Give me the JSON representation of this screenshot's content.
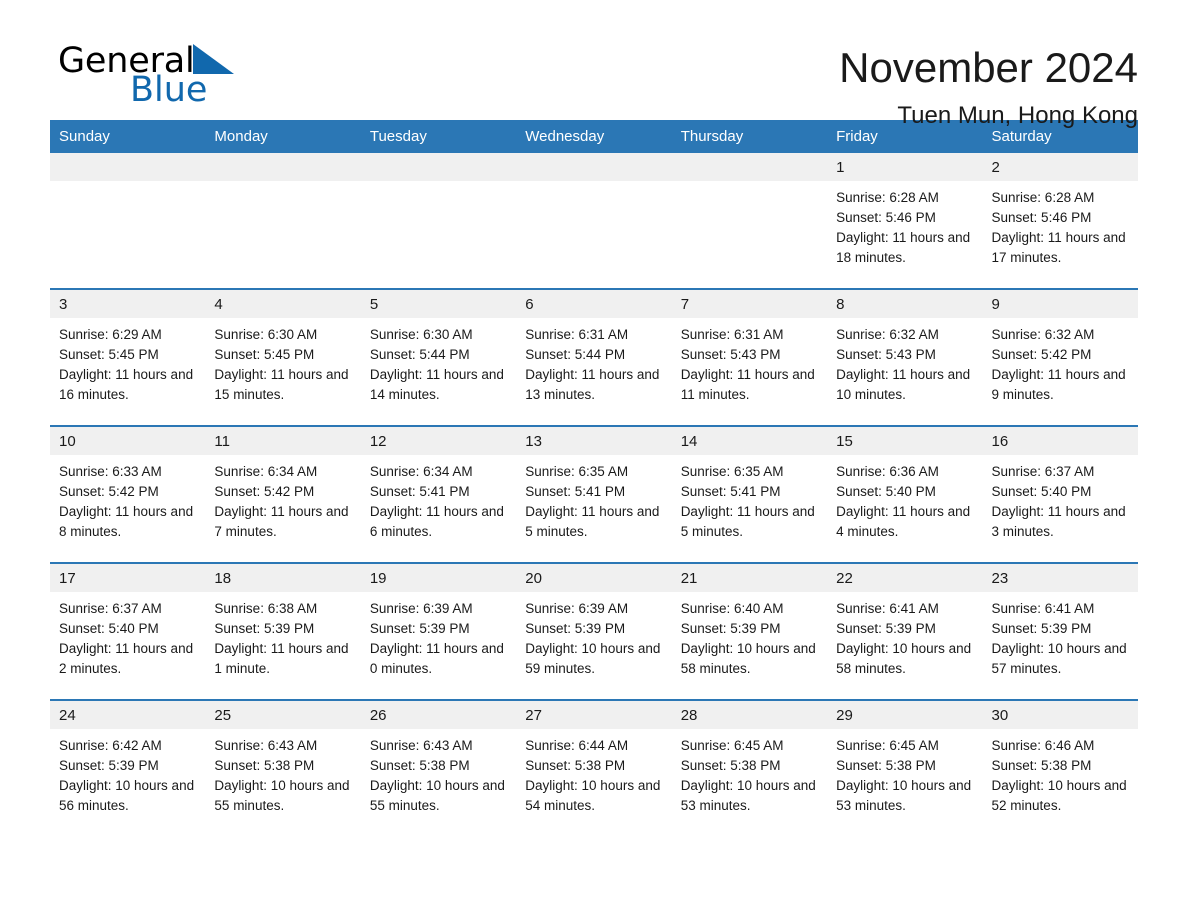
{
  "brand": {
    "name_part1": "General",
    "name_part2": "Blue",
    "triangle_color": "#1168ad"
  },
  "header": {
    "month_title": "November 2024",
    "location": "Tuen Mun, Hong Kong",
    "accent_color": "#2b77b5"
  },
  "calendar": {
    "weekdays": [
      "Sunday",
      "Monday",
      "Tuesday",
      "Wednesday",
      "Thursday",
      "Friday",
      "Saturday"
    ],
    "labels": {
      "sunrise": "Sunrise:",
      "sunset": "Sunset:",
      "daylight": "Daylight:"
    },
    "weeks": [
      [
        {
          "day": "",
          "sunrise": "",
          "sunset": "",
          "daylight": ""
        },
        {
          "day": "",
          "sunrise": "",
          "sunset": "",
          "daylight": ""
        },
        {
          "day": "",
          "sunrise": "",
          "sunset": "",
          "daylight": ""
        },
        {
          "day": "",
          "sunrise": "",
          "sunset": "",
          "daylight": ""
        },
        {
          "day": "",
          "sunrise": "",
          "sunset": "",
          "daylight": ""
        },
        {
          "day": "1",
          "sunrise": "Sunrise: 6:28 AM",
          "sunset": "Sunset: 5:46 PM",
          "daylight": "Daylight: 11 hours and 18 minutes."
        },
        {
          "day": "2",
          "sunrise": "Sunrise: 6:28 AM",
          "sunset": "Sunset: 5:46 PM",
          "daylight": "Daylight: 11 hours and 17 minutes."
        }
      ],
      [
        {
          "day": "3",
          "sunrise": "Sunrise: 6:29 AM",
          "sunset": "Sunset: 5:45 PM",
          "daylight": "Daylight: 11 hours and 16 minutes."
        },
        {
          "day": "4",
          "sunrise": "Sunrise: 6:30 AM",
          "sunset": "Sunset: 5:45 PM",
          "daylight": "Daylight: 11 hours and 15 minutes."
        },
        {
          "day": "5",
          "sunrise": "Sunrise: 6:30 AM",
          "sunset": "Sunset: 5:44 PM",
          "daylight": "Daylight: 11 hours and 14 minutes."
        },
        {
          "day": "6",
          "sunrise": "Sunrise: 6:31 AM",
          "sunset": "Sunset: 5:44 PM",
          "daylight": "Daylight: 11 hours and 13 minutes."
        },
        {
          "day": "7",
          "sunrise": "Sunrise: 6:31 AM",
          "sunset": "Sunset: 5:43 PM",
          "daylight": "Daylight: 11 hours and 11 minutes."
        },
        {
          "day": "8",
          "sunrise": "Sunrise: 6:32 AM",
          "sunset": "Sunset: 5:43 PM",
          "daylight": "Daylight: 11 hours and 10 minutes."
        },
        {
          "day": "9",
          "sunrise": "Sunrise: 6:32 AM",
          "sunset": "Sunset: 5:42 PM",
          "daylight": "Daylight: 11 hours and 9 minutes."
        }
      ],
      [
        {
          "day": "10",
          "sunrise": "Sunrise: 6:33 AM",
          "sunset": "Sunset: 5:42 PM",
          "daylight": "Daylight: 11 hours and 8 minutes."
        },
        {
          "day": "11",
          "sunrise": "Sunrise: 6:34 AM",
          "sunset": "Sunset: 5:42 PM",
          "daylight": "Daylight: 11 hours and 7 minutes."
        },
        {
          "day": "12",
          "sunrise": "Sunrise: 6:34 AM",
          "sunset": "Sunset: 5:41 PM",
          "daylight": "Daylight: 11 hours and 6 minutes."
        },
        {
          "day": "13",
          "sunrise": "Sunrise: 6:35 AM",
          "sunset": "Sunset: 5:41 PM",
          "daylight": "Daylight: 11 hours and 5 minutes."
        },
        {
          "day": "14",
          "sunrise": "Sunrise: 6:35 AM",
          "sunset": "Sunset: 5:41 PM",
          "daylight": "Daylight: 11 hours and 5 minutes."
        },
        {
          "day": "15",
          "sunrise": "Sunrise: 6:36 AM",
          "sunset": "Sunset: 5:40 PM",
          "daylight": "Daylight: 11 hours and 4 minutes."
        },
        {
          "day": "16",
          "sunrise": "Sunrise: 6:37 AM",
          "sunset": "Sunset: 5:40 PM",
          "daylight": "Daylight: 11 hours and 3 minutes."
        }
      ],
      [
        {
          "day": "17",
          "sunrise": "Sunrise: 6:37 AM",
          "sunset": "Sunset: 5:40 PM",
          "daylight": "Daylight: 11 hours and 2 minutes."
        },
        {
          "day": "18",
          "sunrise": "Sunrise: 6:38 AM",
          "sunset": "Sunset: 5:39 PM",
          "daylight": "Daylight: 11 hours and 1 minute."
        },
        {
          "day": "19",
          "sunrise": "Sunrise: 6:39 AM",
          "sunset": "Sunset: 5:39 PM",
          "daylight": "Daylight: 11 hours and 0 minutes."
        },
        {
          "day": "20",
          "sunrise": "Sunrise: 6:39 AM",
          "sunset": "Sunset: 5:39 PM",
          "daylight": "Daylight: 10 hours and 59 minutes."
        },
        {
          "day": "21",
          "sunrise": "Sunrise: 6:40 AM",
          "sunset": "Sunset: 5:39 PM",
          "daylight": "Daylight: 10 hours and 58 minutes."
        },
        {
          "day": "22",
          "sunrise": "Sunrise: 6:41 AM",
          "sunset": "Sunset: 5:39 PM",
          "daylight": "Daylight: 10 hours and 58 minutes."
        },
        {
          "day": "23",
          "sunrise": "Sunrise: 6:41 AM",
          "sunset": "Sunset: 5:39 PM",
          "daylight": "Daylight: 10 hours and 57 minutes."
        }
      ],
      [
        {
          "day": "24",
          "sunrise": "Sunrise: 6:42 AM",
          "sunset": "Sunset: 5:39 PM",
          "daylight": "Daylight: 10 hours and 56 minutes."
        },
        {
          "day": "25",
          "sunrise": "Sunrise: 6:43 AM",
          "sunset": "Sunset: 5:38 PM",
          "daylight": "Daylight: 10 hours and 55 minutes."
        },
        {
          "day": "26",
          "sunrise": "Sunrise: 6:43 AM",
          "sunset": "Sunset: 5:38 PM",
          "daylight": "Daylight: 10 hours and 55 minutes."
        },
        {
          "day": "27",
          "sunrise": "Sunrise: 6:44 AM",
          "sunset": "Sunset: 5:38 PM",
          "daylight": "Daylight: 10 hours and 54 minutes."
        },
        {
          "day": "28",
          "sunrise": "Sunrise: 6:45 AM",
          "sunset": "Sunset: 5:38 PM",
          "daylight": "Daylight: 10 hours and 53 minutes."
        },
        {
          "day": "29",
          "sunrise": "Sunrise: 6:45 AM",
          "sunset": "Sunset: 5:38 PM",
          "daylight": "Daylight: 10 hours and 53 minutes."
        },
        {
          "day": "30",
          "sunrise": "Sunrise: 6:46 AM",
          "sunset": "Sunset: 5:38 PM",
          "daylight": "Daylight: 10 hours and 52 minutes."
        }
      ]
    ]
  }
}
